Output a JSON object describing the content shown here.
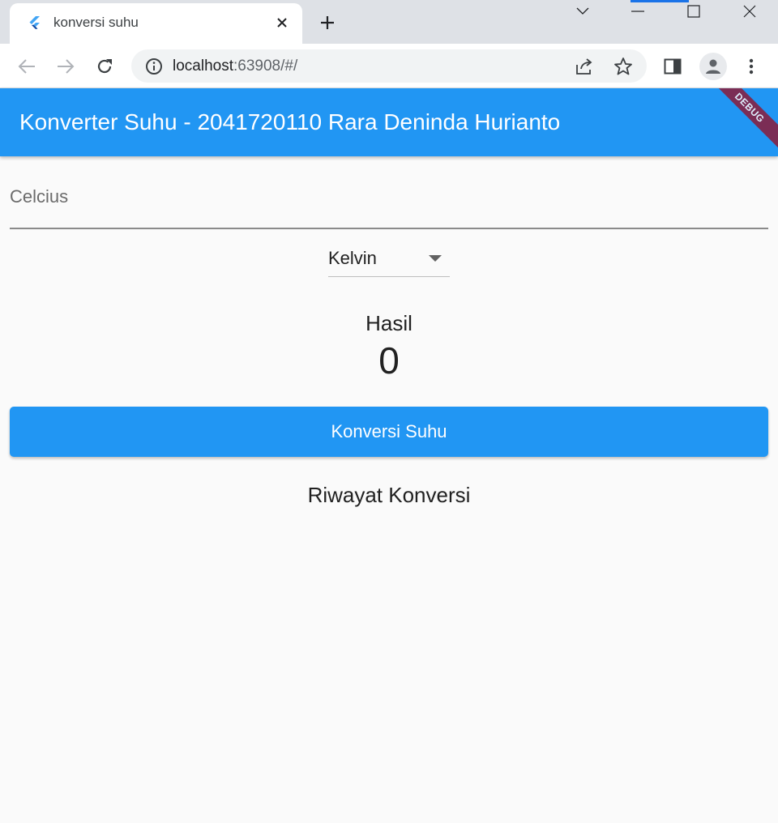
{
  "browser": {
    "tab_title": "konversi suhu",
    "url_host": "localhost",
    "url_rest": ":63908/#/"
  },
  "app": {
    "title": "Konverter Suhu - 2041720110 Rara Deninda Hurianto",
    "debug_label": "DEBUG",
    "input_label": "Celcius",
    "dropdown_value": "Kelvin",
    "dropdown_options": [
      "Kelvin"
    ],
    "result_label": "Hasil",
    "result_value": "0",
    "convert_button": "Konversi Suhu",
    "history_title": "Riwayat Konversi",
    "history_items": []
  },
  "colors": {
    "primary": "#2196f3",
    "debug_banner": "#8b1b3a",
    "background": "#fafafa"
  }
}
